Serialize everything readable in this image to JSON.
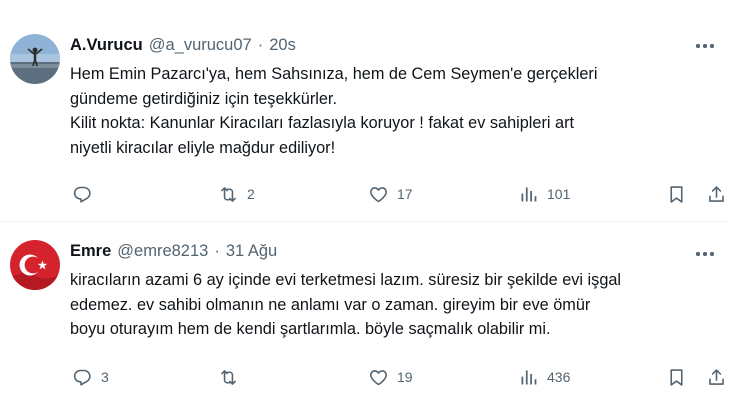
{
  "colors": {
    "text": "#0f1419",
    "secondary": "#536471",
    "divider": "#eff3f4"
  },
  "tweets": [
    {
      "name": "A.Vurucu",
      "handle": "@a_vurucu07",
      "separator": "·",
      "time": "20s",
      "avatar_icon": "landscape-person-avatar",
      "lines": [
        "Hem Emin Pazarcı'ya, hem Sahsınıza, hem de Cem Seymen'e gerçekleri",
        "gündeme getirdiğiniz için teşekkürler.",
        "Kilit nokta: Kanunlar Kiracıları fazlasıyla koruyor ! fakat ev sahipleri art",
        "niyetli kiracılar eliyle mağdur ediliyor!"
      ],
      "replies": "",
      "retweets": "2",
      "likes": "17",
      "views": "101"
    },
    {
      "name": "Emre",
      "handle": "@emre8213",
      "separator": "·",
      "time": "31 Ağu",
      "avatar_icon": "turkish-flag-avatar",
      "lines": [
        "kiracıların azami 6 ay içinde evi terketmesi lazım. süresiz bir şekilde evi işgal",
        "edemez. ev sahibi olmanın ne anlamı var o zaman. gireyim bir eve ömür",
        "boyu oturayım hem de kendi şartlarımla. böyle saçmalık olabilir mi."
      ],
      "replies": "3",
      "retweets": "",
      "likes": "19",
      "views": "436"
    }
  ]
}
